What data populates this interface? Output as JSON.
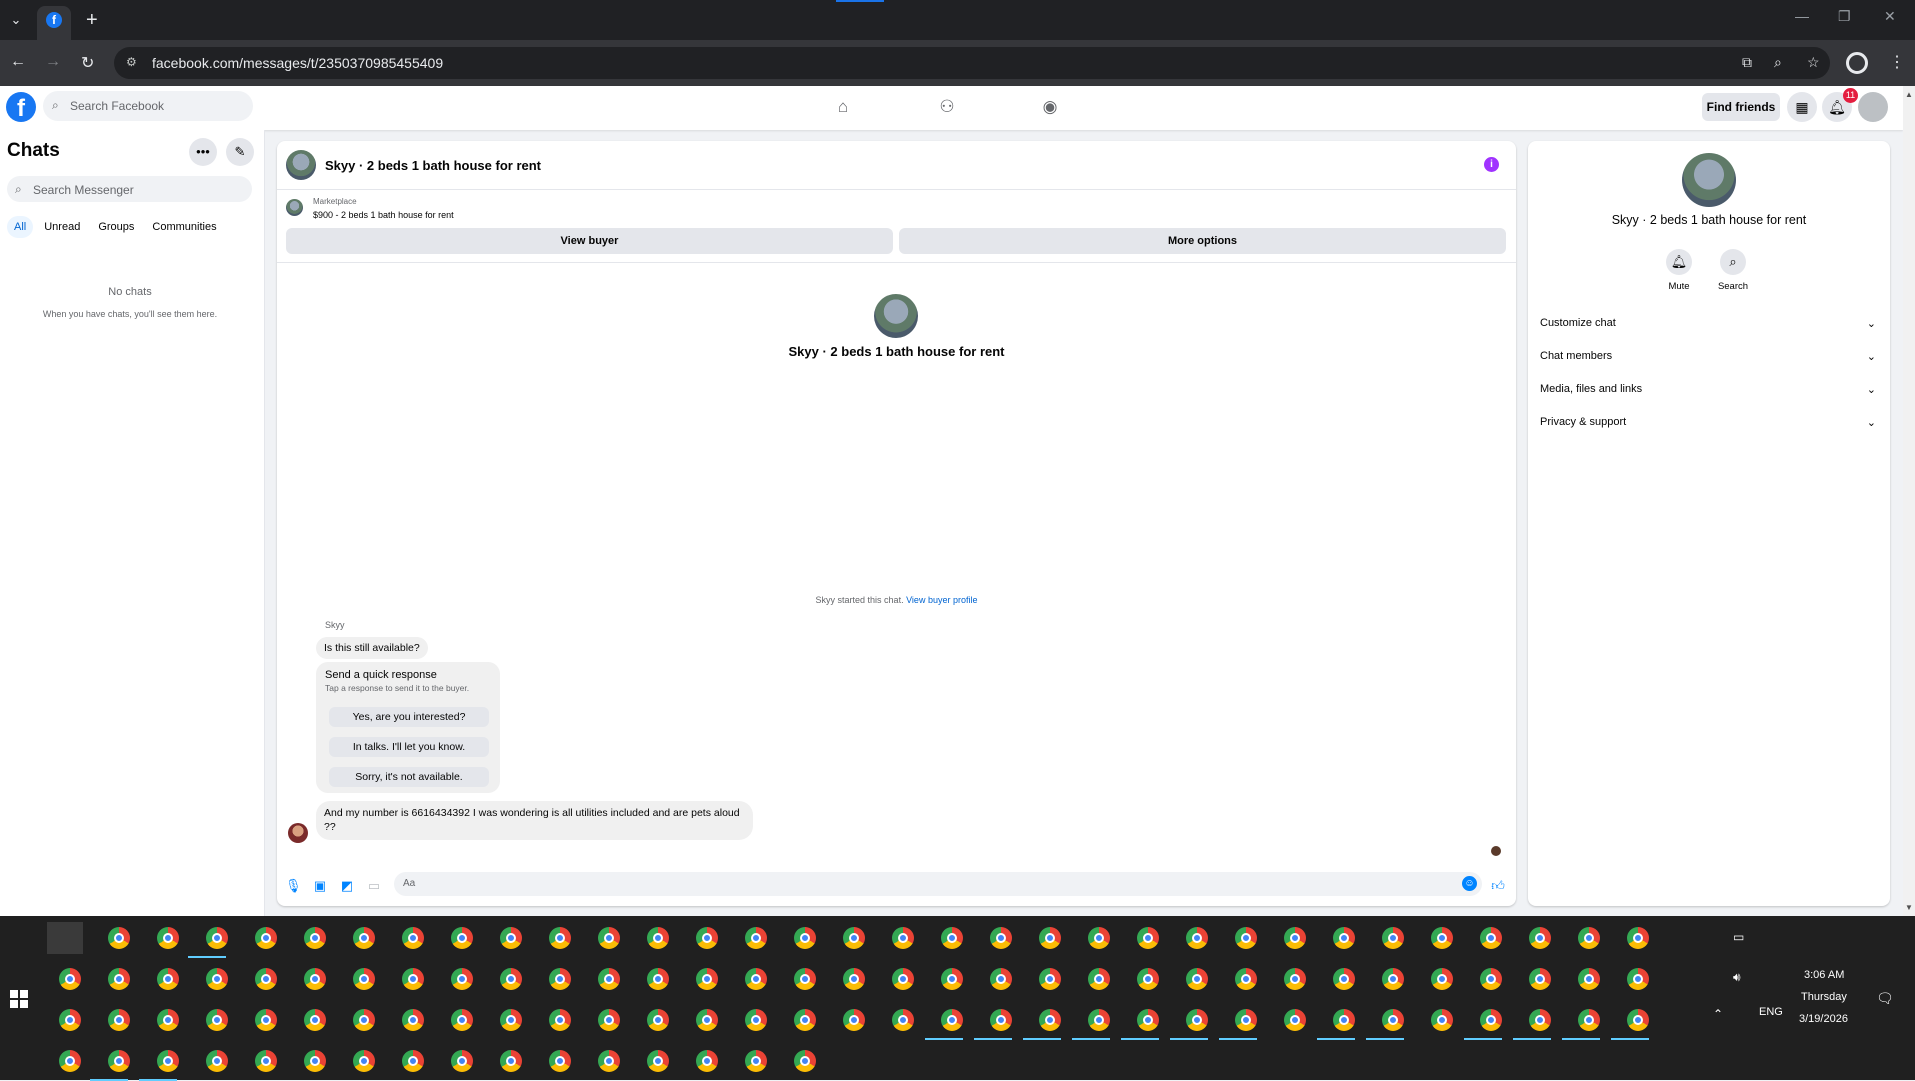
{
  "browser": {
    "url": "facebook.com/messages/t/2350370985455409"
  },
  "facebook": {
    "search_placeholder": "Search Facebook",
    "find_friends_label": "Find friends",
    "notifications_count": "11"
  },
  "sidebar": {
    "title": "Chats",
    "search_placeholder": "Search Messenger",
    "filters": [
      "All",
      "Unread",
      "Groups",
      "Communities"
    ],
    "empty_title": "No chats",
    "empty_subtitle": "When you have chats, you'll see them here."
  },
  "chat": {
    "title": "Skyy · 2 beds 1 bath house for rent",
    "marketplace_label": "Marketplace",
    "listing": "$900 - 2 beds 1 bath house for rent",
    "view_buyer_label": "View buyer",
    "more_options_label": "More options",
    "center_name": "Skyy · 2 beds 1 bath house for rent",
    "started_text": "Skyy started this chat.",
    "view_buyer_profile_label": "View buyer profile",
    "sender_name": "Skyy",
    "message_1": "Is this still available?",
    "quick_response_title": "Send a quick response",
    "quick_response_subtitle": "Tap a response to send it to the buyer.",
    "quick_responses": [
      "Yes, are you interested?",
      "In talks. I'll let you know.",
      "Sorry, it's not available."
    ],
    "message_2": "And my number is 6616434392 I was wondering is all utilities included and are pets aloud ??",
    "composer_placeholder": "Aa"
  },
  "details": {
    "name": "Skyy · 2 beds 1 bath house for rent",
    "mute_label": "Mute",
    "search_label": "Search",
    "sections": [
      "Customize chat",
      "Chat members",
      "Media, files and links",
      "Privacy & support"
    ]
  },
  "taskbar": {
    "time": "3:06 AM",
    "day": "Thursday",
    "date": "3/19/2026",
    "lang": "ENG"
  },
  "colors": {
    "accent": "#0084ff",
    "brand": "#1877f2",
    "info": "#a033ff"
  }
}
